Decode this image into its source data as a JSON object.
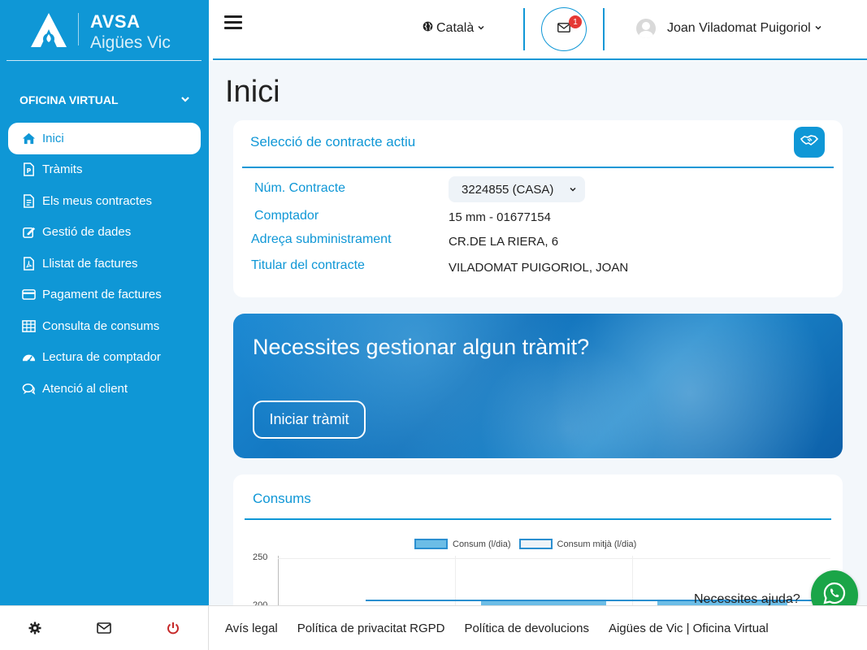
{
  "brand": {
    "title": "AVSA",
    "subtitle": "Aigües Vic"
  },
  "sidebar": {
    "section_label": "OFICINA VIRTUAL",
    "items": [
      {
        "label": "Inici",
        "icon": "home-icon",
        "active": true
      },
      {
        "label": "Tràmits",
        "icon": "document-p-icon"
      },
      {
        "label": "Els meus contractes",
        "icon": "contract-icon"
      },
      {
        "label": "Gestió de dades",
        "icon": "edit-icon"
      },
      {
        "label": "Llistat de factures",
        "icon": "pdf-icon"
      },
      {
        "label": "Pagament de factures",
        "icon": "credit-card-icon"
      },
      {
        "label": "Consulta de consums",
        "icon": "table-icon"
      },
      {
        "label": "Lectura de comptador",
        "icon": "gauge-icon"
      },
      {
        "label": "Atenció al client",
        "icon": "chat-icon"
      }
    ],
    "bottom_icons": [
      "gear-icon",
      "mail-icon",
      "power-icon"
    ]
  },
  "header": {
    "language": "Català",
    "mail_badge": "1",
    "user_name": "Joan Viladomat Puigoriol"
  },
  "main": {
    "page_title": "Inici",
    "contract_card": {
      "title": "Selecció de contracte actiu",
      "rows": [
        {
          "label": "Núm. Contracte",
          "value": "3224855 (CASA)"
        },
        {
          "label": "Comptador",
          "value": "15 mm - 01677154"
        },
        {
          "label": "Adreça subministrament",
          "value": "CR.DE LA RIERA, 6"
        },
        {
          "label": "Titular del contracte",
          "value": "VILADOMAT PUIGORIOL, JOAN"
        }
      ]
    },
    "banner": {
      "title": "Necessites gestionar algun tràmit?",
      "button_label": "Iniciar tràmit"
    },
    "consums_card": {
      "title": "Consums"
    }
  },
  "chart_data": {
    "type": "bar",
    "legend": [
      "Consum (l/dia)",
      "Consum mitjà (l/dia)"
    ],
    "y_ticks": [
      "250",
      "200"
    ],
    "ylim": [
      0,
      250
    ],
    "grid": true,
    "legend_position": "top"
  },
  "help": {
    "text": "Necessites ajuda?"
  },
  "footer": {
    "links": [
      "Avís legal",
      "Política de privacitat RGPD",
      "Política de devolucions",
      "Aigües de Vic | Oficina Virtual"
    ]
  },
  "colors": {
    "accent": "#0f97d6",
    "whatsapp": "#1aa548",
    "badge": "#e53935"
  }
}
